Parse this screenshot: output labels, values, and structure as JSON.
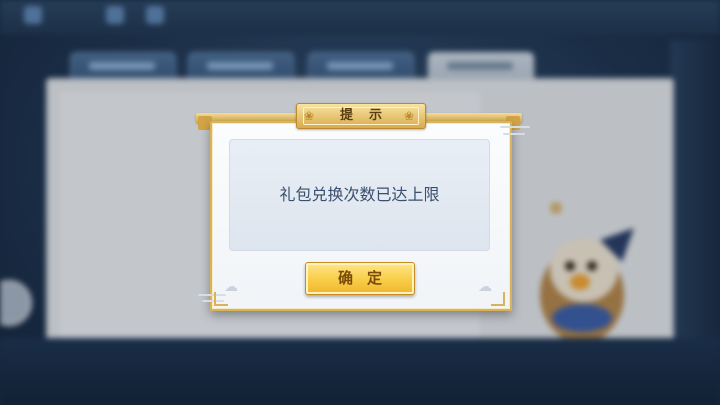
{
  "dialog": {
    "title": "提示",
    "message": "礼包兑换次数已达上限",
    "confirm_label": "确定"
  },
  "background": {
    "tab_count": 4,
    "active_tab_index": 3
  },
  "colors": {
    "gold_accent": "#d9b35a",
    "button_gold": "#f9cf4c",
    "message_text": "#3b4f6f",
    "message_bg": "#e3eaf2"
  },
  "icons": {
    "title_ornament_left": "cloud-swirl-icon",
    "title_ornament_right": "cloud-swirl-icon"
  }
}
